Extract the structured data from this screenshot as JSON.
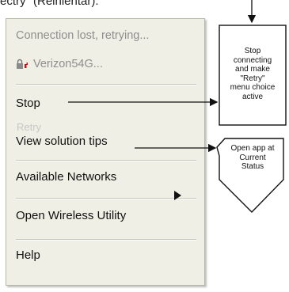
{
  "top_caption": "ectry\" (Reinientar).",
  "menu": {
    "status_text": "Connection lost, retrying...",
    "network_name": "Verizon54G...",
    "items": [
      {
        "label": "Stop"
      },
      {
        "label": "Retry"
      },
      {
        "label": "View solution tips"
      },
      {
        "label": "Available Networks"
      },
      {
        "label": "Open Wireless Utility"
      },
      {
        "label": "Help"
      }
    ]
  },
  "callouts": {
    "stop": [
      "Stop",
      "connecting",
      "and make",
      "\"Retry\"",
      "menu choice",
      "active"
    ],
    "solution": [
      "Open app at",
      "Current",
      "Status"
    ]
  },
  "icons": {
    "lock": "lock-icon",
    "signal": "signal-error-icon",
    "submenu": "submenu-arrow-icon"
  },
  "colors": {
    "menu_bg": "#f0efe6",
    "lock_red": "#cc1111"
  }
}
